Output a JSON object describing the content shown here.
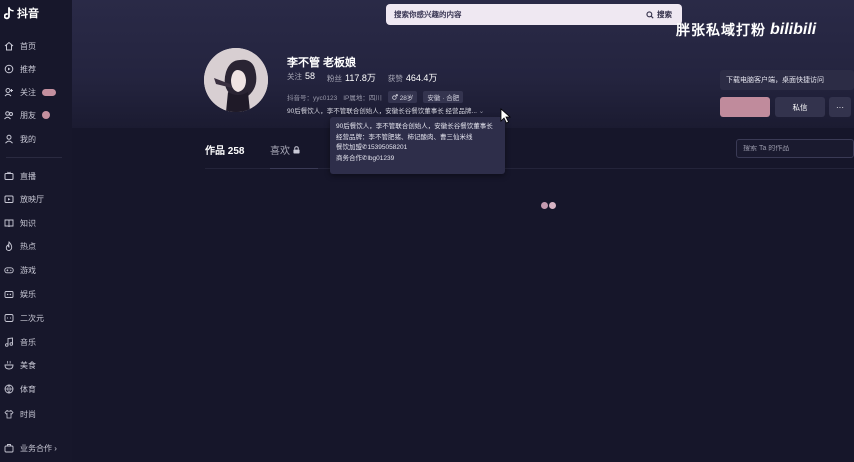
{
  "app": {
    "logo_text": "抖音"
  },
  "sidebar": {
    "items": [
      {
        "label": "首页",
        "icon": "home-icon"
      },
      {
        "label": "推荐",
        "icon": "recommend-icon"
      },
      {
        "label": "关注",
        "icon": "follow-icon"
      },
      {
        "label": "朋友",
        "icon": "friends-icon"
      },
      {
        "label": "我的",
        "icon": "profile-icon"
      },
      {
        "label": "直播",
        "icon": "live-icon"
      },
      {
        "label": "放映厅",
        "icon": "cinema-icon"
      },
      {
        "label": "知识",
        "icon": "knowledge-icon"
      },
      {
        "label": "热点",
        "icon": "hot-icon"
      },
      {
        "label": "游戏",
        "icon": "game-icon"
      },
      {
        "label": "娱乐",
        "icon": "entertainment-icon"
      },
      {
        "label": "二次元",
        "icon": "anime-icon"
      },
      {
        "label": "音乐",
        "icon": "music-icon"
      },
      {
        "label": "美食",
        "icon": "food-icon"
      },
      {
        "label": "体育",
        "icon": "sports-icon"
      },
      {
        "label": "时尚",
        "icon": "fashion-icon"
      }
    ],
    "footer": "业务合作 ›"
  },
  "search": {
    "placeholder": "搜索你感兴趣的内容",
    "button_label": "搜索"
  },
  "watermark": {
    "text": "胖张私域打粉",
    "logo": "bilibili"
  },
  "profile": {
    "name": "李不管 老板娘",
    "stats": {
      "following_label": "关注",
      "following": "58",
      "followers_label": "粉丝",
      "followers": "117.8万",
      "likes_label": "获赞",
      "likes": "464.4万"
    },
    "meta": {
      "id": "抖音号：yyc0123",
      "ip": "IP属地：四川",
      "age": "28岁",
      "location": "安徽 · 合肥"
    },
    "bio_preview": "90后餐饮人，李不管联合创始人，安徽长谷餐饮董事长 经营品牌..."
  },
  "bio_popup": {
    "lines": [
      "90后餐饮人，李不管联合创始人，安徽长谷餐饮董事长",
      "经营品牌：李不管肥猪、柿记酸肉、曹三仙米线",
      "餐饮加盟✆15395058201",
      "商务合作✆lbg01239"
    ]
  },
  "actions": {
    "download_banner": "下载电脑客户端，桌面快捷访问",
    "message": "私信",
    "more": "···"
  },
  "tabs": {
    "works": "作品 258",
    "likes": "喜欢"
  },
  "works_search": {
    "placeholder": "搜索 Ta 的作品"
  },
  "colors": {
    "background": "#16162a",
    "accent": "#c08b9c",
    "search_bg": "#efe8f2"
  }
}
